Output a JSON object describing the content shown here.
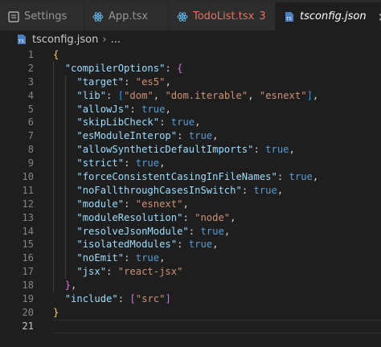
{
  "tabs": [
    {
      "label": "Settings",
      "icon": "settings-file-icon",
      "active": false
    },
    {
      "label": "App.tsx",
      "icon": "react-icon",
      "active": false
    },
    {
      "label": "TodoList.tsx",
      "icon": "react-icon",
      "active": false,
      "problems": "3",
      "modified": true
    },
    {
      "label": "tsconfig.json",
      "icon": "ts-json-icon",
      "active": true,
      "close": "×"
    }
  ],
  "breadcrumb": {
    "file": "tsconfig.json",
    "more": "..."
  },
  "editor": {
    "line_numbers": [
      "1",
      "2",
      "3",
      "4",
      "5",
      "6",
      "7",
      "8",
      "9",
      "10",
      "11",
      "12",
      "13",
      "14",
      "15",
      "16",
      "17",
      "18",
      "19",
      "20",
      "21"
    ],
    "current_line": 21,
    "colors": {
      "key": "#9cdcfe",
      "string": "#ce9178",
      "keyword": "#569cd6",
      "bracket1": "#ffd700",
      "bracket2": "#da70d6",
      "bracket3": "#179fff"
    },
    "tokens": {
      "open_root": "{",
      "compiler_options": "\"compilerOptions\"",
      "colon": ":",
      "comma": ",",
      "open_obj": "{",
      "close_obj": "}",
      "open_arr": "[",
      "close_arr": "]",
      "true": "true",
      "lines": [
        {
          "key": "\"target\"",
          "value": "\"es5\""
        },
        {
          "key": "\"lib\"",
          "values": [
            "\"dom\"",
            "\"dom.iterable\"",
            "\"esnext\""
          ]
        },
        {
          "key": "\"allowJs\"",
          "value": "true"
        },
        {
          "key": "\"skipLibCheck\"",
          "value": "true"
        },
        {
          "key": "\"esModuleInterop\"",
          "value": "true"
        },
        {
          "key": "\"allowSyntheticDefaultImports\"",
          "value": "true"
        },
        {
          "key": "\"strict\"",
          "value": "true"
        },
        {
          "key": "\"forceConsistentCasingInFileNames\"",
          "value": "true"
        },
        {
          "key": "\"noFallthroughCasesInSwitch\"",
          "value": "true"
        },
        {
          "key": "\"module\"",
          "value": "\"esnext\""
        },
        {
          "key": "\"moduleResolution\"",
          "value": "\"node\""
        },
        {
          "key": "\"resolveJsonModule\"",
          "value": "true"
        },
        {
          "key": "\"isolatedModules\"",
          "value": "true"
        },
        {
          "key": "\"noEmit\"",
          "value": "true"
        },
        {
          "key": "\"jsx\"",
          "value": "\"react-jsx\""
        }
      ],
      "include_key": "\"include\"",
      "include_value": "\"src\"",
      "close_root": "}"
    }
  }
}
